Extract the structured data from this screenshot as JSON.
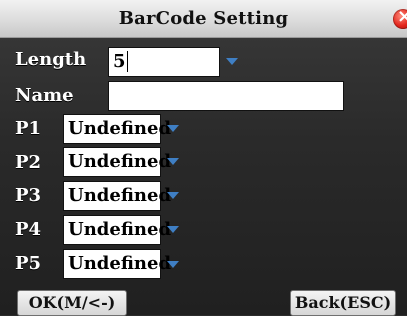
{
  "window": {
    "title": "BarCode Setting"
  },
  "fields": {
    "length": {
      "label": "Length",
      "value": "5"
    },
    "name": {
      "label": "Name",
      "value": ""
    }
  },
  "params": [
    {
      "label": "P1",
      "value": "Undefined"
    },
    {
      "label": "P2",
      "value": "Undefined"
    },
    {
      "label": "P3",
      "value": "Undefined"
    },
    {
      "label": "P4",
      "value": "Undefined"
    },
    {
      "label": "P5",
      "value": "Undefined"
    }
  ],
  "buttons": {
    "ok": "OK(M/<-)",
    "back": "Back(ESC)"
  },
  "colors": {
    "accent_arrow": "#3f7fc4",
    "close_button": "#e2251c"
  },
  "icons": {
    "close": "close-icon",
    "dropdown": "chevron-down-icon"
  }
}
